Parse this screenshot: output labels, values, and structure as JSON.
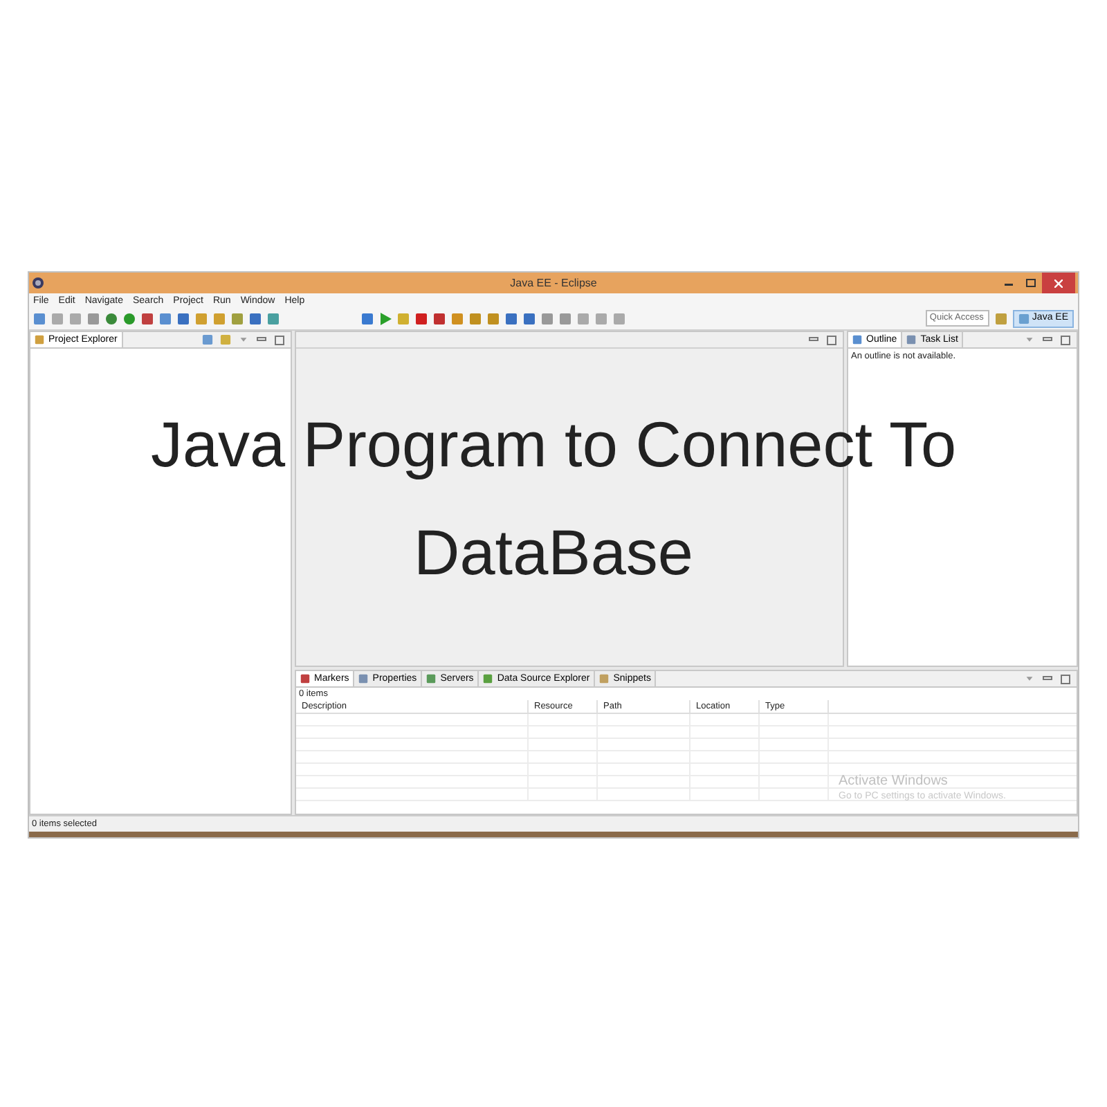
{
  "window": {
    "title": "Java EE - Eclipse"
  },
  "menu": [
    "File",
    "Edit",
    "Navigate",
    "Search",
    "Project",
    "Run",
    "Window",
    "Help"
  ],
  "toolbar": {
    "quick_access": {
      "placeholder": "Quick Access"
    },
    "perspective": {
      "label": "Java EE",
      "selected": true
    }
  },
  "project_explorer": {
    "tab": {
      "label": "Project Explorer",
      "selected": true
    }
  },
  "outline": {
    "tabs": [
      {
        "label": "Outline",
        "selected": true
      },
      {
        "label": "Task List",
        "selected": false
      }
    ],
    "message": "An outline is not available."
  },
  "bottom_panel": {
    "tabs": [
      {
        "label": "Markers",
        "selected": true
      },
      {
        "label": "Properties",
        "selected": false
      },
      {
        "label": "Servers",
        "selected": false
      },
      {
        "label": "Data Source Explorer",
        "selected": false
      },
      {
        "label": "Snippets",
        "selected": false
      }
    ],
    "count": "0 items",
    "columns": [
      "Description",
      "Resource",
      "Path",
      "Location",
      "Type"
    ]
  },
  "status_bar": "0 items selected",
  "overlay_title": "Java Program to Connect To DataBase",
  "activation_notice": {
    "title": "Activate Windows",
    "detail": "Go to PC settings to activate Windows."
  }
}
